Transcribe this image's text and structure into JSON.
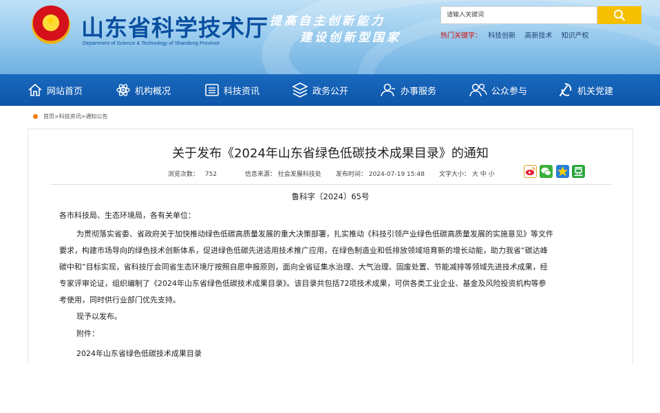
{
  "header": {
    "title": "山东省科学技术厅",
    "subtitle": "Department of Science & Technology of Shandong Province",
    "slogan_line1": "提高自主创新能力",
    "slogan_line2": "建设创新型国家",
    "search_placeholder": "请输入关键词",
    "hot_label": "热门关键字：",
    "hot_keywords": [
      "科技创新",
      "高新技术",
      "知识产权"
    ]
  },
  "nav": {
    "items": [
      {
        "label": "网站首页",
        "icon": "home-icon"
      },
      {
        "label": "机构概况",
        "icon": "atom-icon"
      },
      {
        "label": "科技资讯",
        "icon": "news-icon"
      },
      {
        "label": "政务公开",
        "icon": "layers-icon"
      },
      {
        "label": "办事服务",
        "icon": "user-service-icon"
      },
      {
        "label": "公众参与",
        "icon": "people-icon"
      },
      {
        "label": "机关党建",
        "icon": "party-icon"
      }
    ]
  },
  "breadcrumb": "首页>科技资讯>通知公告",
  "article": {
    "title": "关于发布《2024年山东省绿色低碳技术成果目录》的通知",
    "views_label": "浏览次数：",
    "views": "752",
    "source_label": "信息来源：",
    "source": "社会发展科技处",
    "date_label": "发布时间：",
    "date": "2024-07-19 15:48",
    "font_label": "文字大小：",
    "font_sizes": "大 中 小",
    "doc_number": "鲁科字〔2024〕65号",
    "salutation": "各市科技局、生态环境局，各有关单位：",
    "body_lines": [
      "为贯彻落实省委、省政府关于加快推动绿色低碳高质量发展的重大决策部署，扎实推动《科技引领产业绿色低碳高质量发展的实施意见》等文件",
      "要求，构建市场导向的绿色技术创新体系，促进绿色低碳先进适用技术推广应用，在绿色制造业和低排放领域培育新的增长动能，助力我省“碳达峰",
      "碳中和”目标实现，省科技厅会同省生态环境厅按照自愿申报原则，面向全省征集水治理、大气治理、固废处置、节能减排等领域先进技术成果，经",
      "专家评审论证，组织编制了《2024年山东省绿色低碳技术成果目录》。该目录共包括72项技术成果，可供各类工业企业、基金及风险投资机构等参",
      "考使用，同时供行业部门优先支持。"
    ],
    "closing": "现予以发布。",
    "attachment_label": "附件：",
    "attachment": "2024年山东省绿色低碳技术成果目录"
  },
  "colors": {
    "nav_bg": "#0d55a8",
    "title_blue": "#0a4fa0",
    "search_button": "#f5c000",
    "hot_label": "#d10c0c"
  }
}
